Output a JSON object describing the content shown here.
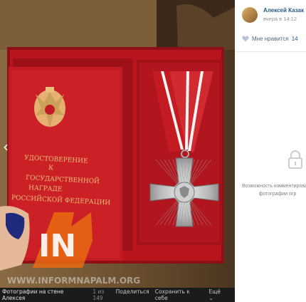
{
  "panel": {
    "author_name": "Алексей Казак",
    "author_time": "вчера в 14:12",
    "likes_label": "Мне нравится",
    "likes_count": "14",
    "restricted_line1": "Возможность комментирования",
    "restricted_line2": "фотографии огр"
  },
  "photo": {
    "booklet_text": [
      "УДОСТОВЕРЕНИЕ",
      "К",
      "ГОСУДАРСТВЕННОЙ",
      "НАГРАДЕ",
      "РОССИЙСКОЙ ФЕДЕРАЦИИ"
    ],
    "watermark": "WWW.INFORMNAPALM.ORG",
    "logo_text": "IN"
  },
  "bottom": {
    "title": "Фотографии на стене Алексея",
    "counter": "1 из 149",
    "share": "Поделиться",
    "save": "Сохранить к себе",
    "more": "Ещё"
  },
  "colors": {
    "link": "#2a5885",
    "box_red": "#b8151c",
    "booklet_red": "#c41b22",
    "gold": "#e8c07a"
  }
}
